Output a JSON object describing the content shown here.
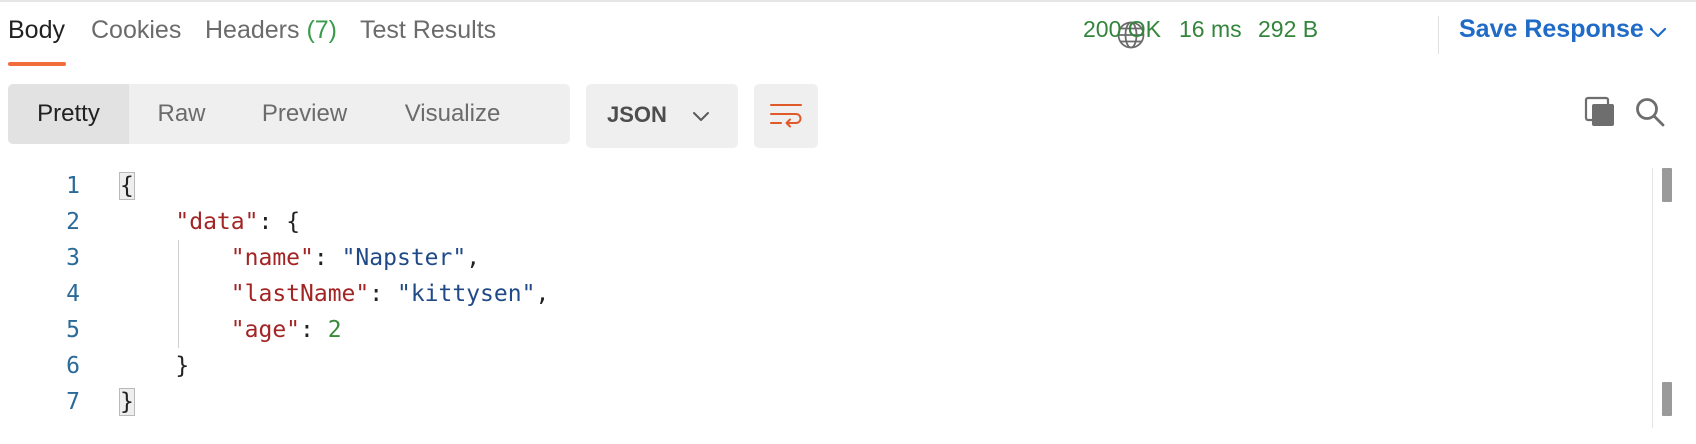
{
  "tabs": [
    {
      "label": "Body"
    },
    {
      "label": "Cookies"
    },
    {
      "label": "Headers",
      "count": "(7)"
    },
    {
      "label": "Test Results"
    }
  ],
  "status": {
    "code": "200 OK",
    "time": "16 ms",
    "size": "292 B",
    "color": "#34853c"
  },
  "save_response": {
    "label": "Save Response"
  },
  "view_modes": [
    "Pretty",
    "Raw",
    "Preview",
    "Visualize"
  ],
  "selected_view": "Pretty",
  "format": {
    "selected": "JSON"
  },
  "icons": {
    "globe": "globe-icon",
    "wrap": "wrap-lines-icon",
    "copy": "copy-icon",
    "search": "search-icon"
  },
  "accent_color": "#f26b3a",
  "code": {
    "line_numbers": [
      "1",
      "2",
      "3",
      "4",
      "5",
      "6",
      "7"
    ],
    "open_brace": "{",
    "close_brace": "}",
    "data_key": "\"data\"",
    "name_key": "\"name\"",
    "name_value": "\"Napster\"",
    "last_name_key": "\"lastName\"",
    "last_name_value": "\"kittysen\"",
    "age_key": "\"age\"",
    "age_value": "2"
  }
}
